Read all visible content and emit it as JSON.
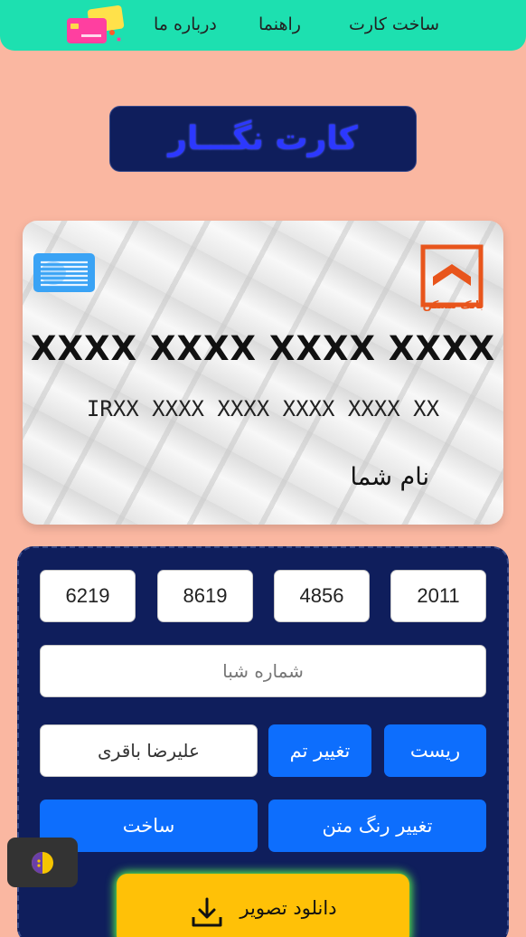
{
  "nav": {
    "items": [
      {
        "label": "ساخت کارت"
      },
      {
        "label": "راهنما"
      },
      {
        "label": "درباره ما"
      }
    ]
  },
  "title": "کارت نگـــار",
  "card": {
    "bank_name": "بانک مسکن",
    "number": "XXXX XXXX XXXX XXXX",
    "iban": "IRXX XXXX XXXX XXXX XXXX XX",
    "holder": "نام شما"
  },
  "form": {
    "number_groups": [
      "2011",
      "4856",
      "8619",
      "6219"
    ],
    "iban_placeholder": "شماره شبا",
    "name_value": "علیرضا باقری",
    "reset_label": "ریست",
    "theme_label": "تغییر تم",
    "text_color_label": "تغییر رنگ متن",
    "build_label": "ساخت",
    "download_label": "دانلود تصویر"
  },
  "colors": {
    "background": "#fab7a1",
    "navbar": "#1de0b0",
    "panel": "#0f1e5c",
    "primary_button": "#0d6efd",
    "download_button": "#ffc107",
    "bank_accent": "#e8551c"
  }
}
